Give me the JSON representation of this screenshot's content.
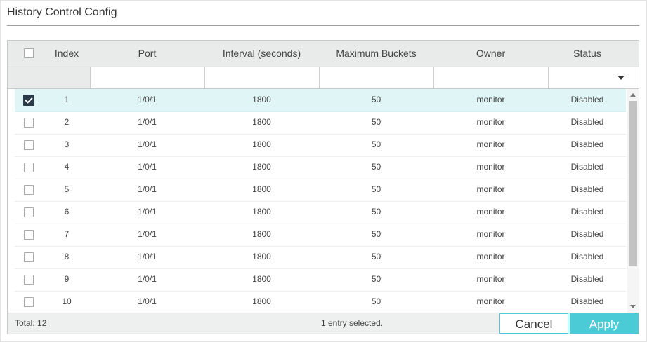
{
  "page": {
    "title": "History Control Config"
  },
  "table": {
    "columns": [
      "Index",
      "Port",
      "Interval (seconds)",
      "Maximum Buckets",
      "Owner",
      "Status"
    ],
    "rows": [
      {
        "index": "1",
        "port": "1/0/1",
        "interval": "1800",
        "buckets": "50",
        "owner": "monitor",
        "status": "Disabled",
        "selected": true
      },
      {
        "index": "2",
        "port": "1/0/1",
        "interval": "1800",
        "buckets": "50",
        "owner": "monitor",
        "status": "Disabled",
        "selected": false
      },
      {
        "index": "3",
        "port": "1/0/1",
        "interval": "1800",
        "buckets": "50",
        "owner": "monitor",
        "status": "Disabled",
        "selected": false
      },
      {
        "index": "4",
        "port": "1/0/1",
        "interval": "1800",
        "buckets": "50",
        "owner": "monitor",
        "status": "Disabled",
        "selected": false
      },
      {
        "index": "5",
        "port": "1/0/1",
        "interval": "1800",
        "buckets": "50",
        "owner": "monitor",
        "status": "Disabled",
        "selected": false
      },
      {
        "index": "6",
        "port": "1/0/1",
        "interval": "1800",
        "buckets": "50",
        "owner": "monitor",
        "status": "Disabled",
        "selected": false
      },
      {
        "index": "7",
        "port": "1/0/1",
        "interval": "1800",
        "buckets": "50",
        "owner": "monitor",
        "status": "Disabled",
        "selected": false
      },
      {
        "index": "8",
        "port": "1/0/1",
        "interval": "1800",
        "buckets": "50",
        "owner": "monitor",
        "status": "Disabled",
        "selected": false
      },
      {
        "index": "9",
        "port": "1/0/1",
        "interval": "1800",
        "buckets": "50",
        "owner": "monitor",
        "status": "Disabled",
        "selected": false
      },
      {
        "index": "10",
        "port": "1/0/1",
        "interval": "1800",
        "buckets": "50",
        "owner": "monitor",
        "status": "Disabled",
        "selected": false
      }
    ]
  },
  "footer": {
    "total": "Total: 12",
    "selection": "1 entry selected.",
    "cancel_label": "Cancel",
    "apply_label": "Apply"
  },
  "colors": {
    "accent": "#4acbd6",
    "selected_row": "#dff5f6",
    "header_bg": "#e9ebeb",
    "checkbox_checked": "#2b3a48"
  }
}
